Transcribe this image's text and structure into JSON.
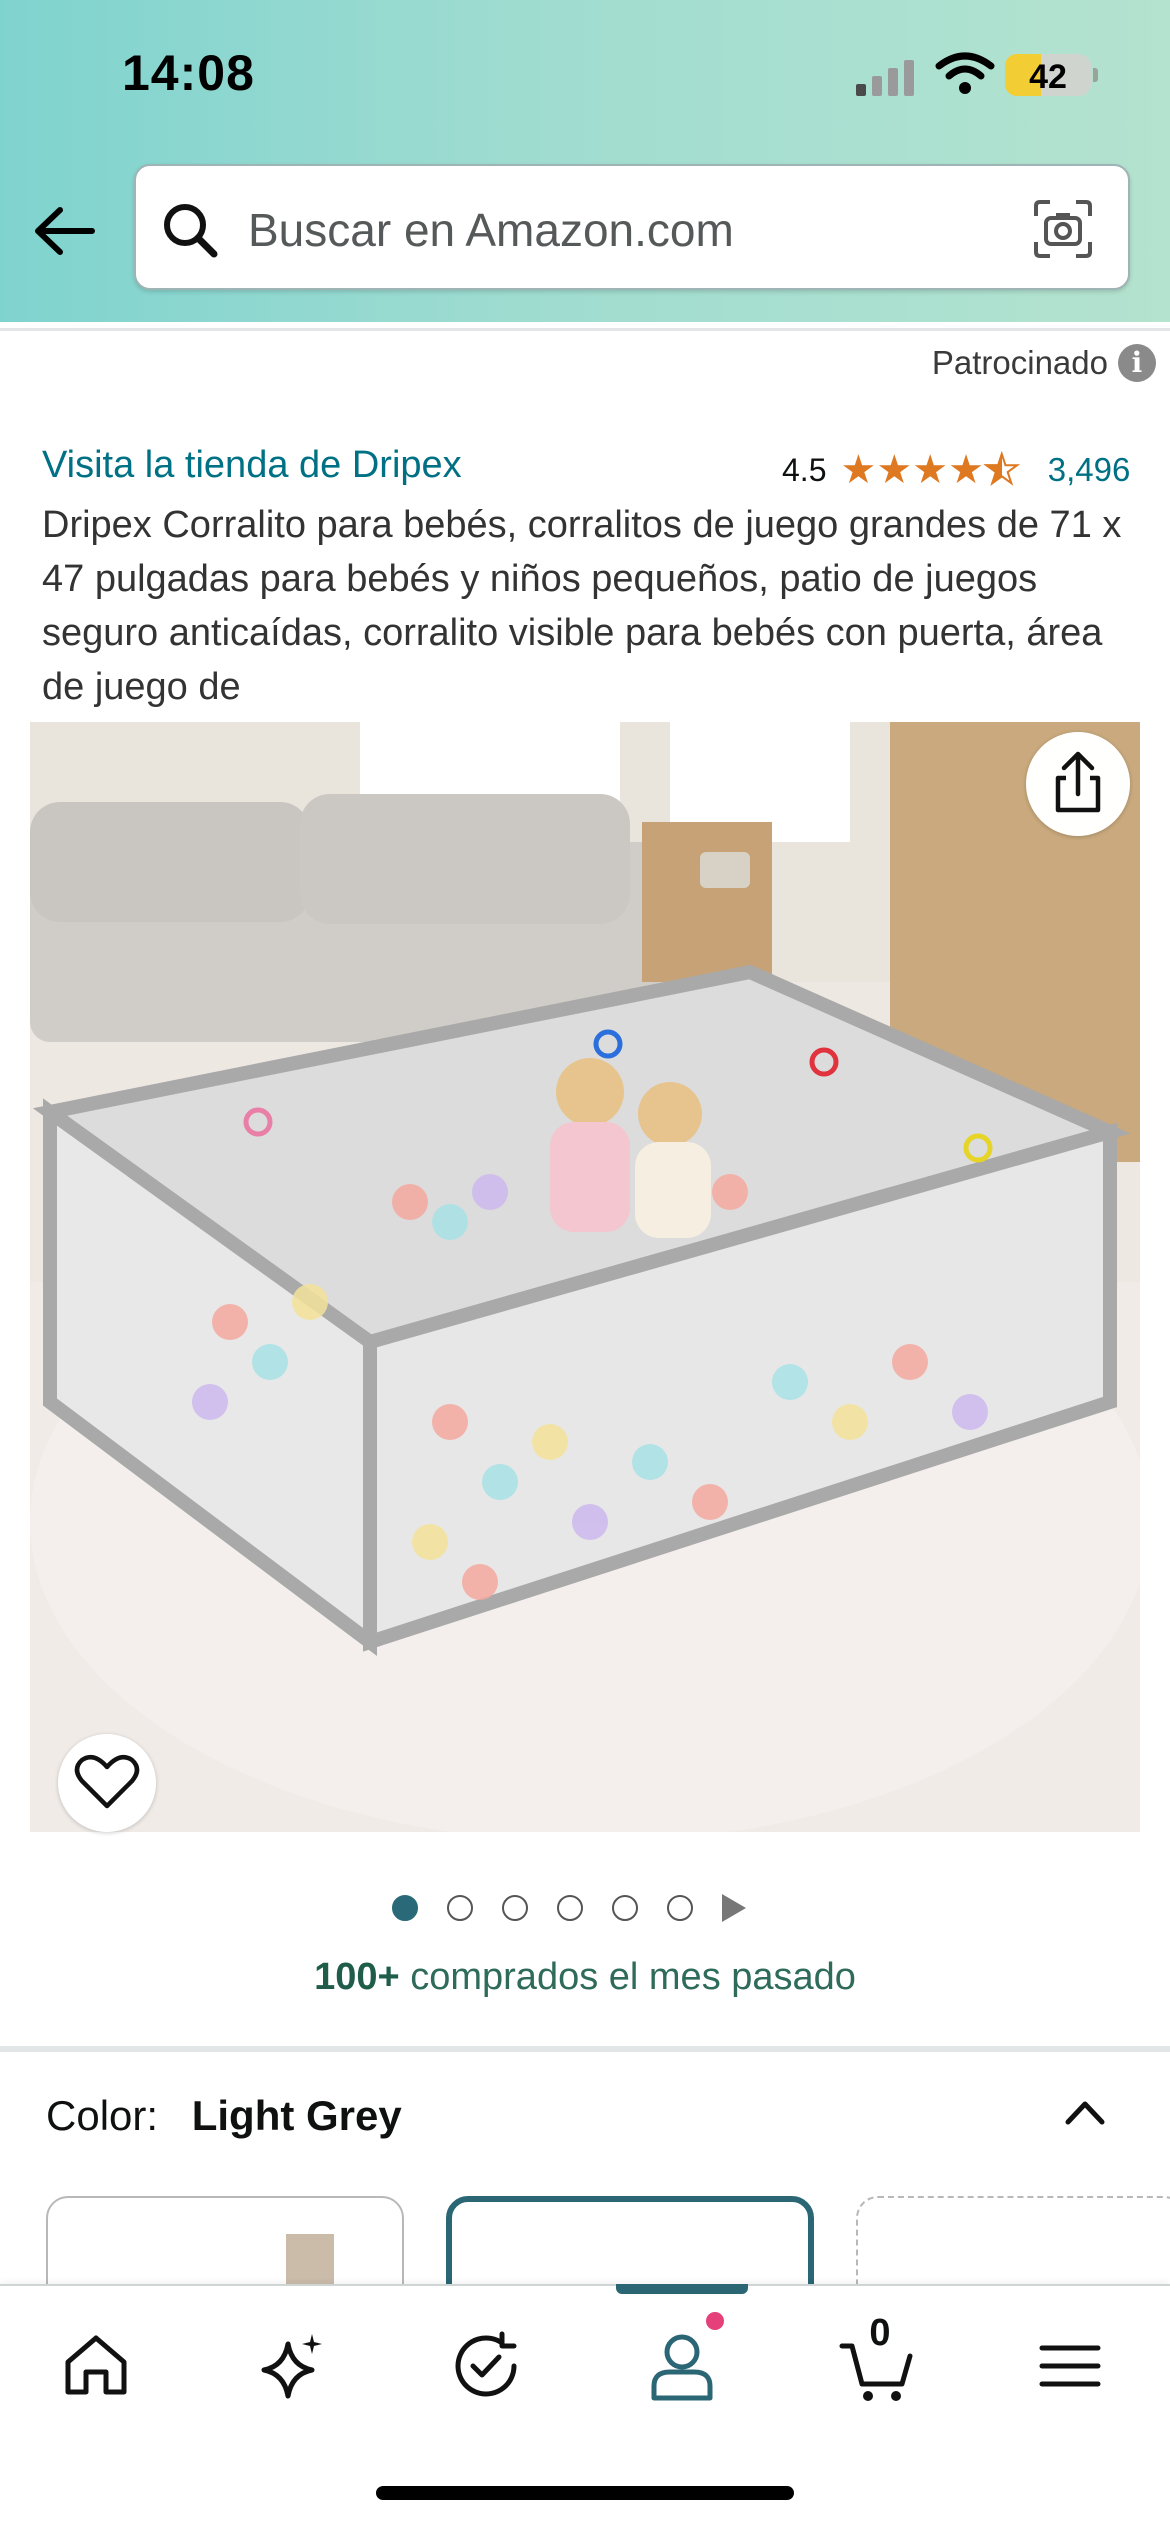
{
  "status_bar": {
    "time": "14:08",
    "battery": "42"
  },
  "search": {
    "placeholder": "Buscar en Amazon.com"
  },
  "ad": {
    "sponsored_label": "Patrocinado"
  },
  "product": {
    "store_link": "Visita la tienda de Dripex",
    "rating": "4.5",
    "rating_value": 4.5,
    "review_count": "3,496",
    "title": "Dripex Corralito para bebés, corralitos de juego grandes de 71 x 47 pulgadas para bebés y niños pequeños, patio de juegos seguro anticaídas, corralito visible para bebés con puerta, área de juego de",
    "image_count": 6,
    "active_image": 1,
    "bought_count": "100+",
    "bought_text": "comprados el mes pasado"
  },
  "variation": {
    "label": "Color:",
    "value": "Light Grey"
  },
  "bottom_nav": {
    "items": [
      "home-icon",
      "sparkle-icon",
      "orders-icon",
      "account-icon",
      "cart-icon",
      "menu-icon"
    ],
    "cart_count": "0"
  },
  "colors": {
    "link": "#007185",
    "star": "#de7921",
    "accent": "#2b6675"
  }
}
